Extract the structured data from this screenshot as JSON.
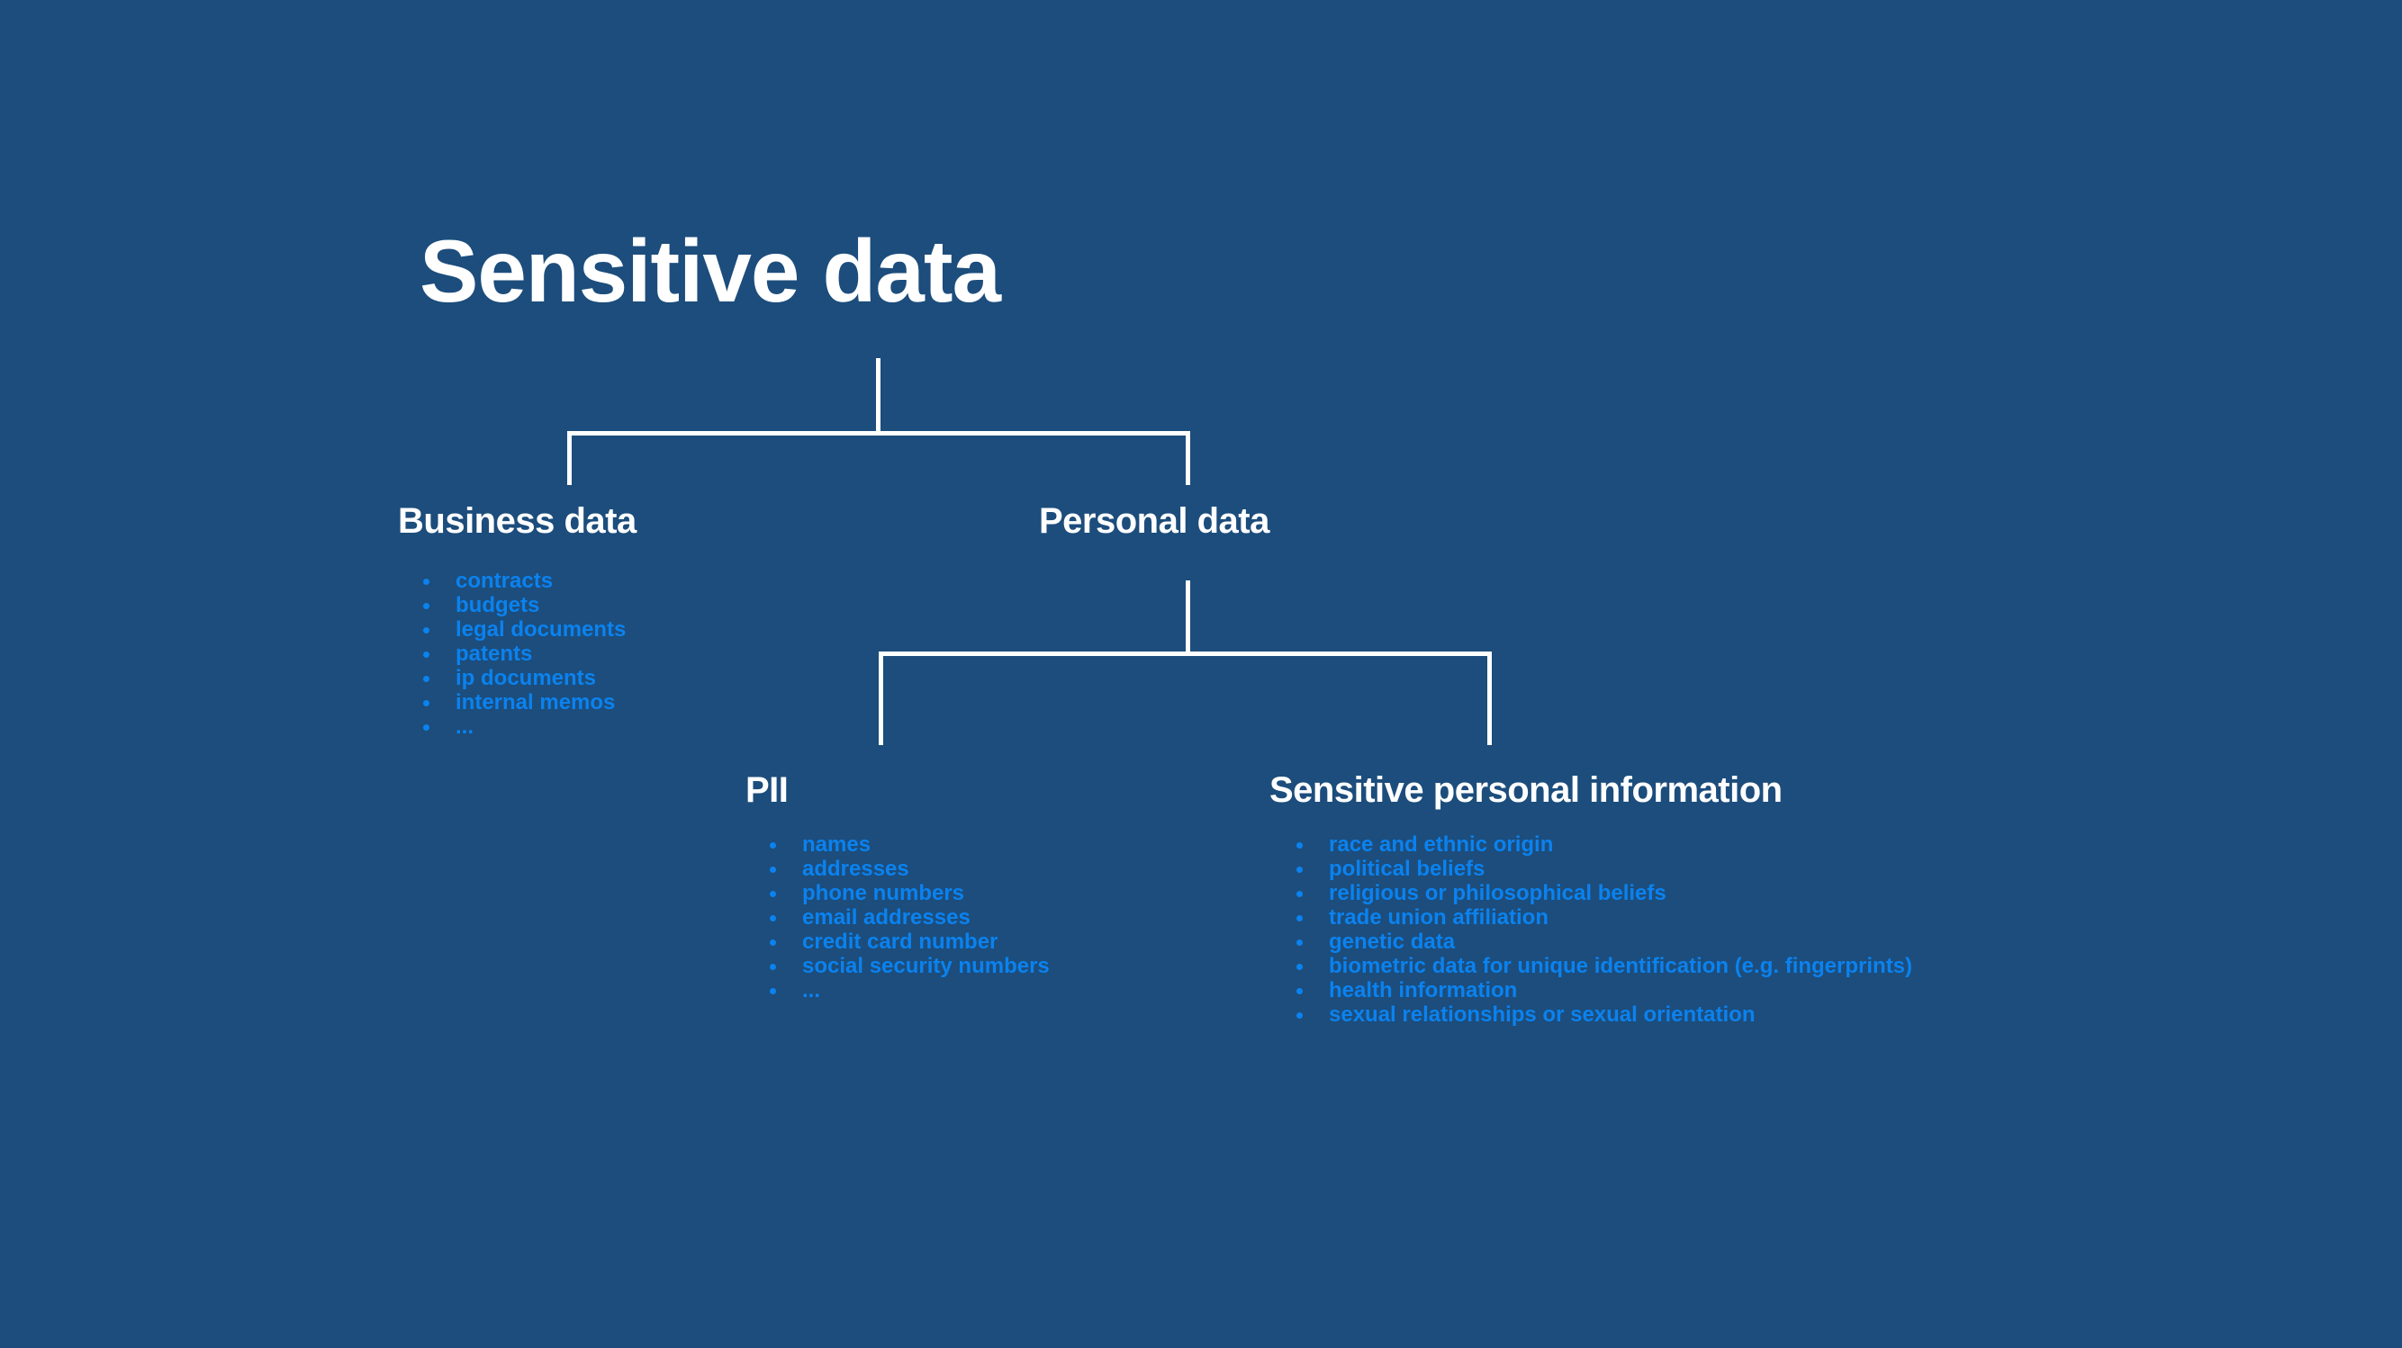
{
  "theme": {
    "background": "#1c4d7c",
    "heading_color": "#ffffff",
    "list_color": "#0b82ef",
    "connector_color": "#ffffff"
  },
  "diagram": {
    "type": "tree",
    "root": {
      "label": "Sensitive data"
    },
    "nodes": [
      {
        "id": "business-data",
        "label": "Business data",
        "items": [
          "contracts",
          "budgets",
          "legal documents",
          "patents",
          "ip documents",
          "internal memos",
          "..."
        ]
      },
      {
        "id": "personal-data",
        "label": "Personal data",
        "items": []
      },
      {
        "id": "pii",
        "label": "PII",
        "items": [
          "names",
          "addresses",
          "phone numbers",
          "email addresses",
          "credit card number",
          "social security numbers",
          "..."
        ]
      },
      {
        "id": "sensitive-personal-information",
        "label": "Sensitive personal information",
        "items": [
          "race and ethnic origin",
          "political beliefs",
          "religious or philosophical beliefs",
          "trade union affiliation",
          "genetic data",
          "biometric data for unique identification (e.g. fingerprints)",
          "health information",
          "sexual relationships or sexual orientation"
        ]
      }
    ]
  }
}
